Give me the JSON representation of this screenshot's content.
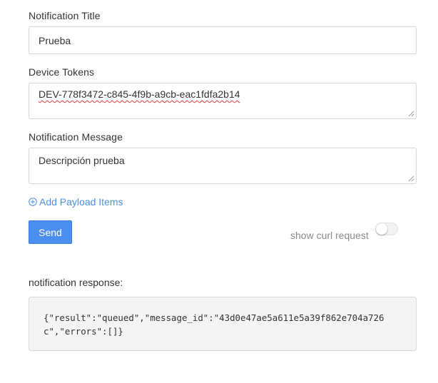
{
  "form": {
    "title_label": "Notification Title",
    "title_value": "Prueba",
    "tokens_label": "Device Tokens",
    "tokens_value": "DEV-778f3472-c845-4f9b-a9cb-eac1fdfa2b14",
    "message_label": "Notification Message",
    "message_value": "Descripción prueba",
    "add_payload_label": "Add Payload Items",
    "send_label": "Send",
    "curl_label": "show curl request",
    "curl_toggle_on": false
  },
  "response": {
    "label": "notification response:",
    "body": "{\"result\":\"queued\",\"message_id\":\"43d0e47ae5a611e5a39f862e704a726c\",\"errors\":[]}"
  },
  "colors": {
    "accent": "#4a8ff0",
    "link": "#4a90e2",
    "spellcheck": "#e23b3b"
  }
}
